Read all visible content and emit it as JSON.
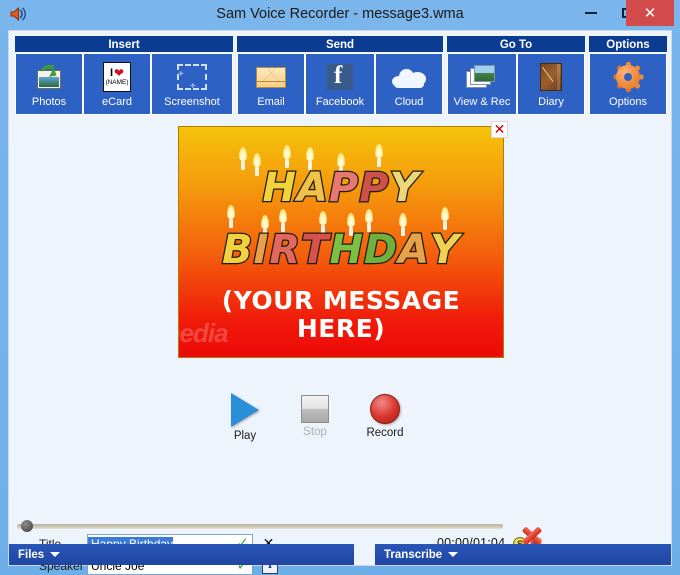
{
  "window": {
    "title": "Sam Voice Recorder - message3.wma",
    "app_icon": "speaker-icon",
    "minimize_label": "–",
    "maximize_label": "❑",
    "close_label": "✕"
  },
  "ribbon": {
    "groups": [
      {
        "name": "Insert",
        "header": "Insert",
        "buttons": [
          {
            "label": "Photos",
            "icon": "photo-import-icon"
          },
          {
            "label": "eCard",
            "icon": "ecard-icon"
          },
          {
            "label": "Screenshot",
            "icon": "screenshot-icon"
          }
        ]
      },
      {
        "name": "Send",
        "header": "Send",
        "buttons": [
          {
            "label": "Email",
            "icon": "envelope-icon"
          },
          {
            "label": "Facebook",
            "icon": "facebook-icon"
          },
          {
            "label": "Cloud",
            "icon": "cloud-icon"
          }
        ]
      },
      {
        "name": "Go To",
        "header": "Go To",
        "buttons": [
          {
            "label": "View & Rec",
            "icon": "photo-stack-icon"
          },
          {
            "label": "Diary",
            "icon": "diary-book-icon"
          }
        ]
      },
      {
        "name": "Options",
        "header": "Options",
        "buttons": [
          {
            "label": "Options",
            "icon": "gear-icon"
          }
        ]
      }
    ]
  },
  "card": {
    "line1": "HAPPY",
    "line2": "BIRTHDAY",
    "message": "(YOUR MESSAGE HERE)",
    "watermark": "softpedia",
    "close_label": "✕",
    "colors": {
      "top": "#f5c20a",
      "bottom": "#ee0a08"
    },
    "letters1": [
      {
        "ch": "H",
        "color": "#f2d33a"
      },
      {
        "ch": "A",
        "color": "#f0c24a"
      },
      {
        "ch": "P",
        "color": "#e8776f"
      },
      {
        "ch": "P",
        "color": "#cf4f49"
      },
      {
        "ch": "Y",
        "color": "#ecd77a"
      }
    ],
    "letters2": [
      {
        "ch": "B",
        "color": "#f1d23e"
      },
      {
        "ch": "I",
        "color": "#e8a04a"
      },
      {
        "ch": "R",
        "color": "#e2675f"
      },
      {
        "ch": "T",
        "color": "#d6524c"
      },
      {
        "ch": "H",
        "color": "#7bc043"
      },
      {
        "ch": "D",
        "color": "#6fb13c"
      },
      {
        "ch": "A",
        "color": "#e8a24a"
      },
      {
        "ch": "Y",
        "color": "#f0d253"
      }
    ]
  },
  "transport": {
    "play_label": "Play",
    "stop_label": "Stop",
    "record_label": "Record",
    "stop_disabled": true
  },
  "seek": {
    "position_percent": 0
  },
  "fields": {
    "title_label": "Title",
    "title_value": "Happy Birthday",
    "title_selected": true,
    "title_valid_icon": "check-icon",
    "clear_title_label": "✕",
    "speaker_label": "Speaker",
    "speaker_value": "Uncle Joe",
    "speaker_valid_icon": "check-icon",
    "speaker_format_icon": "text-format-icon",
    "speaker_format_glyph": "T"
  },
  "playback": {
    "timecode": "00:00/01:04",
    "cost_icon": "coin-delete-icon",
    "coin_glyph": "S"
  },
  "statusbar": {
    "files_label": "Files",
    "transcribe_label": "Transcribe"
  }
}
